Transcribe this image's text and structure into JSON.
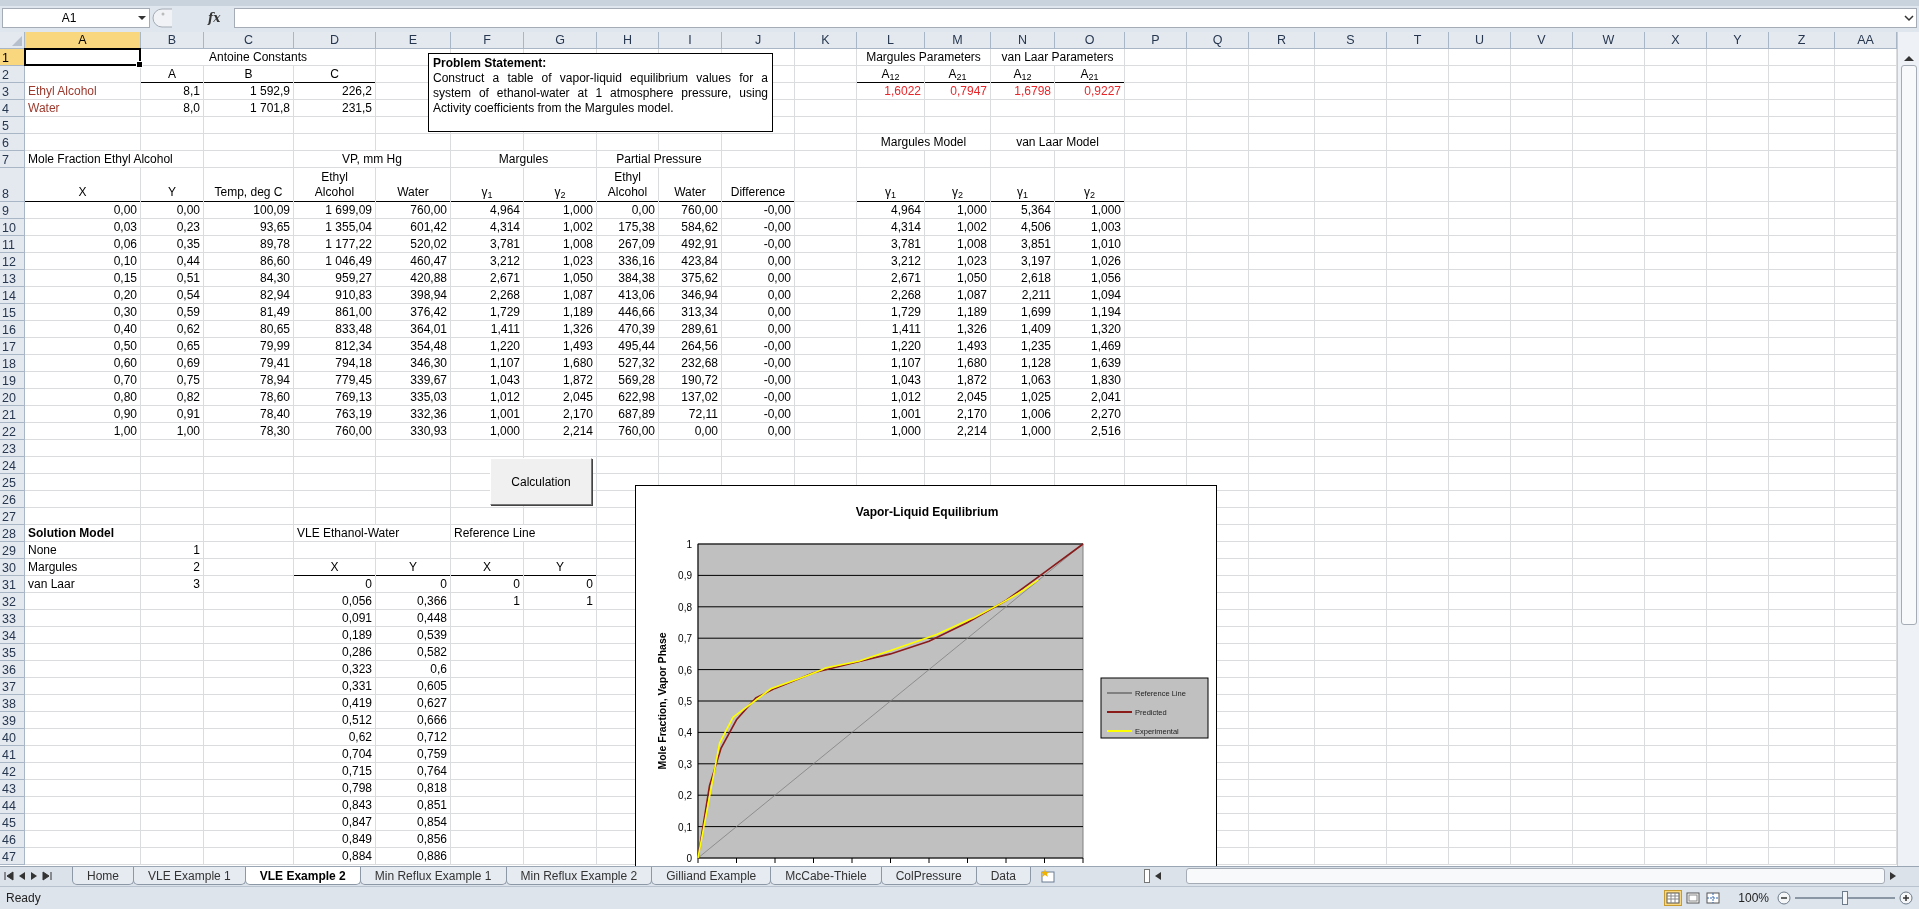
{
  "formula_bar": {
    "name_box": "A1",
    "function_label": "fx"
  },
  "sheet": {
    "columns": [
      {
        "label": "A",
        "selected": true
      },
      {
        "label": "B",
        "selected": false
      },
      {
        "label": "C",
        "selected": false
      },
      {
        "label": "D",
        "selected": false
      },
      {
        "label": "E",
        "selected": false
      },
      {
        "label": "F",
        "selected": false
      },
      {
        "label": "G",
        "selected": false
      },
      {
        "label": "H",
        "selected": false
      },
      {
        "label": "I",
        "selected": false
      },
      {
        "label": "J",
        "selected": false
      },
      {
        "label": "K",
        "selected": false
      },
      {
        "label": "L",
        "selected": false
      },
      {
        "label": "M",
        "selected": false
      },
      {
        "label": "N",
        "selected": false
      },
      {
        "label": "O",
        "selected": false
      },
      {
        "label": "P",
        "selected": false
      },
      {
        "label": "Q",
        "selected": false
      },
      {
        "label": "R",
        "selected": false
      },
      {
        "label": "S",
        "selected": false
      },
      {
        "label": "T",
        "selected": false
      },
      {
        "label": "U",
        "selected": false
      },
      {
        "label": "V",
        "selected": false
      },
      {
        "label": "W",
        "selected": false
      },
      {
        "label": "X",
        "selected": false
      },
      {
        "label": "Y",
        "selected": false
      },
      {
        "label": "Z",
        "selected": false
      },
      {
        "label": "AA",
        "selected": false
      }
    ],
    "rows": [
      {
        "label": "1",
        "selected": true,
        "cells": [
          {
            "selected": true
          },
          {
            "text": "Antoine Constants",
            "kind": "group"
          },
          null,
          null,
          null,
          null,
          null,
          null,
          null,
          null,
          null,
          {
            "text": "Margules Parameters",
            "kind": "group"
          },
          null,
          {
            "text": "van Laar Parameters",
            "kind": "group"
          }
        ]
      },
      {
        "label": "2",
        "selected": false,
        "cells": [
          null,
          {
            "text": "A",
            "kind": "header",
            "underlined": true
          },
          {
            "text": "B",
            "kind": "header",
            "underlined": true
          },
          {
            "text": "C",
            "kind": "header",
            "underlined": true
          },
          null,
          null,
          null,
          null,
          null,
          null,
          null,
          {
            "text": "A$_{12}$",
            "kind": "header",
            "underlined": true
          },
          {
            "text": "A$_{21}$",
            "kind": "header",
            "underlined": true
          },
          {
            "text": "A$_{12}$",
            "kind": "header",
            "underlined": true
          },
          {
            "text": "A$_{21}$",
            "kind": "header",
            "underlined": true
          }
        ]
      },
      {
        "label": "3",
        "selected": false,
        "cells": [
          {
            "text": "Ethyl Alcohol",
            "kind": "label",
            "color": "#9c3a2e"
          },
          {
            "text": "8,1",
            "kind": "number"
          },
          {
            "text": "1 592,9",
            "kind": "number"
          },
          {
            "text": "226,2",
            "kind": "number"
          },
          null,
          null,
          null,
          null,
          null,
          null,
          null,
          {
            "text": "1,6022",
            "kind": "number",
            "color": "#e8262a"
          },
          {
            "text": "0,7947",
            "kind": "number",
            "color": "#e8262a"
          },
          {
            "text": "1,6798",
            "kind": "number",
            "color": "#e8262a"
          },
          {
            "text": "0,9227",
            "kind": "number",
            "color": "#e8262a"
          }
        ]
      },
      {
        "label": "4",
        "selected": false,
        "cells": [
          {
            "text": "Water",
            "kind": "label",
            "color": "#9c3a2e"
          },
          {
            "text": "8,0",
            "kind": "number"
          },
          {
            "text": "1 701,8",
            "kind": "number"
          },
          {
            "text": "231,5",
            "kind": "number"
          }
        ]
      },
      {
        "label": "5",
        "selected": false
      },
      {
        "label": "6",
        "selected": false,
        "cells": [
          null,
          null,
          null,
          null,
          null,
          null,
          null,
          null,
          null,
          null,
          null,
          {
            "text": "Margules Model",
            "kind": "group"
          },
          null,
          {
            "text": "van Laar Model",
            "kind": "group"
          }
        ]
      },
      {
        "label": "7",
        "selected": false,
        "cells": [
          {
            "text": "Mole Fraction Ethyl Alcohol",
            "kind": "label"
          },
          null,
          null,
          {
            "text": "VP, mm Hg",
            "kind": "group"
          },
          null,
          {
            "text": "Margules",
            "kind": "group"
          },
          null,
          {
            "text": "Partial Pressure",
            "kind": "group"
          }
        ]
      },
      {
        "label": "8",
        "selected": false,
        "cells": [
          {
            "text": "X",
            "kind": "column-header",
            "underlined": true
          },
          {
            "text": "Y",
            "kind": "column-header",
            "underlined": true
          },
          {
            "text": "Temp, deg C",
            "kind": "column-header",
            "underlined": true
          },
          {
            "text": "Ethyl\nAlcohol",
            "kind": "column-header",
            "underlined": true
          },
          {
            "text": "Water",
            "kind": "column-header",
            "underlined": true
          },
          {
            "text": "γ$_{1}$",
            "kind": "column-header",
            "underlined": true
          },
          {
            "text": "γ$_{2}$",
            "kind": "column-header",
            "underlined": true
          },
          {
            "text": "Ethyl\nAlcohol",
            "kind": "column-header",
            "underlined": true
          },
          {
            "text": "Water",
            "kind": "column-header",
            "underlined": true
          },
          {
            "text": "Difference",
            "kind": "column-header",
            "underlined": true
          },
          null,
          {
            "text": "γ$_{1}$",
            "kind": "column-header",
            "underlined": true
          },
          {
            "text": "γ$_{2}$",
            "kind": "column-header",
            "underlined": true
          },
          {
            "text": "γ$_{1}$",
            "kind": "column-header",
            "underlined": true
          },
          {
            "text": "γ$_{2}$",
            "kind": "column-header",
            "underlined": true
          }
        ]
      },
      {
        "label": "9",
        "selected": false,
        "cells": [
          {
            "text": "0,00",
            "kind": "number"
          },
          {
            "text": "0,00",
            "kind": "number"
          },
          {
            "text": "100,09",
            "kind": "number"
          },
          {
            "text": "1 699,09",
            "kind": "number"
          },
          {
            "text": "760,00",
            "kind": "number"
          },
          {
            "text": "4,964",
            "kind": "number"
          },
          {
            "text": "1,000",
            "kind": "number"
          },
          {
            "text": "0,00",
            "kind": "number"
          },
          {
            "text": "760,00",
            "kind": "number"
          },
          {
            "text": "-0,00",
            "kind": "number"
          },
          null,
          {
            "text": "4,964",
            "kind": "number"
          },
          {
            "text": "1,000",
            "kind": "number"
          },
          {
            "text": "5,364",
            "kind": "number"
          },
          {
            "text": "1,000",
            "kind": "number"
          }
        ]
      },
      {
        "label": "10",
        "selected": false,
        "cells": [
          {
            "text": "0,03",
            "kind": "number"
          },
          {
            "text": "0,23",
            "kind": "number"
          },
          {
            "text": "93,65",
            "kind": "number"
          },
          {
            "text": "1 355,04",
            "kind": "number"
          },
          {
            "text": "601,42",
            "kind": "number"
          },
          {
            "text": "4,314",
            "kind": "number"
          },
          {
            "text": "1,002",
            "kind": "number"
          },
          {
            "text": "175,38",
            "kind": "number"
          },
          {
            "text": "584,62",
            "kind": "number"
          },
          {
            "text": "-0,00",
            "kind": "number"
          },
          null,
          {
            "text": "4,314",
            "kind": "number"
          },
          {
            "text": "1,002",
            "kind": "number"
          },
          {
            "text": "4,506",
            "kind": "number"
          },
          {
            "text": "1,003",
            "kind": "number"
          }
        ]
      },
      {
        "label": "11",
        "selected": false,
        "cells": [
          {
            "text": "0,06",
            "kind": "number"
          },
          {
            "text": "0,35",
            "kind": "number"
          },
          {
            "text": "89,78",
            "kind": "number"
          },
          {
            "text": "1 177,22",
            "kind": "number"
          },
          {
            "text": "520,02",
            "kind": "number"
          },
          {
            "text": "3,781",
            "kind": "number"
          },
          {
            "text": "1,008",
            "kind": "number"
          },
          {
            "text": "267,09",
            "kind": "number"
          },
          {
            "text": "492,91",
            "kind": "number"
          },
          {
            "text": "-0,00",
            "kind": "number"
          },
          null,
          {
            "text": "3,781",
            "kind": "number"
          },
          {
            "text": "1,008",
            "kind": "number"
          },
          {
            "text": "3,851",
            "kind": "number"
          },
          {
            "text": "1,010",
            "kind": "number"
          }
        ]
      },
      {
        "label": "12",
        "selected": false,
        "cells": [
          {
            "text": "0,10",
            "kind": "number"
          },
          {
            "text": "0,44",
            "kind": "number"
          },
          {
            "text": "86,60",
            "kind": "number"
          },
          {
            "text": "1 046,49",
            "kind": "number"
          },
          {
            "text": "460,47",
            "kind": "number"
          },
          {
            "text": "3,212",
            "kind": "number"
          },
          {
            "text": "1,023",
            "kind": "number"
          },
          {
            "text": "336,16",
            "kind": "number"
          },
          {
            "text": "423,84",
            "kind": "number"
          },
          {
            "text": "0,00",
            "kind": "number"
          },
          null,
          {
            "text": "3,212",
            "kind": "number"
          },
          {
            "text": "1,023",
            "kind": "number"
          },
          {
            "text": "3,197",
            "kind": "number"
          },
          {
            "text": "1,026",
            "kind": "number"
          }
        ]
      },
      {
        "label": "13",
        "selected": false,
        "cells": [
          {
            "text": "0,15",
            "kind": "number"
          },
          {
            "text": "0,51",
            "kind": "number"
          },
          {
            "text": "84,30",
            "kind": "number"
          },
          {
            "text": "959,27",
            "kind": "number"
          },
          {
            "text": "420,88",
            "kind": "number"
          },
          {
            "text": "2,671",
            "kind": "number"
          },
          {
            "text": "1,050",
            "kind": "number"
          },
          {
            "text": "384,38",
            "kind": "number"
          },
          {
            "text": "375,62",
            "kind": "number"
          },
          {
            "text": "0,00",
            "kind": "number"
          },
          null,
          {
            "text": "2,671",
            "kind": "number"
          },
          {
            "text": "1,050",
            "kind": "number"
          },
          {
            "text": "2,618",
            "kind": "number"
          },
          {
            "text": "1,056",
            "kind": "number"
          }
        ]
      },
      {
        "label": "14",
        "selected": false,
        "cells": [
          {
            "text": "0,20",
            "kind": "number"
          },
          {
            "text": "0,54",
            "kind": "number"
          },
          {
            "text": "82,94",
            "kind": "number"
          },
          {
            "text": "910,83",
            "kind": "number"
          },
          {
            "text": "398,94",
            "kind": "number"
          },
          {
            "text": "2,268",
            "kind": "number"
          },
          {
            "text": "1,087",
            "kind": "number"
          },
          {
            "text": "413,06",
            "kind": "number"
          },
          {
            "text": "346,94",
            "kind": "number"
          },
          {
            "text": "0,00",
            "kind": "number"
          },
          null,
          {
            "text": "2,268",
            "kind": "number"
          },
          {
            "text": "1,087",
            "kind": "number"
          },
          {
            "text": "2,211",
            "kind": "number"
          },
          {
            "text": "1,094",
            "kind": "number"
          }
        ]
      },
      {
        "label": "15",
        "selected": false,
        "cells": [
          {
            "text": "0,30",
            "kind": "number"
          },
          {
            "text": "0,59",
            "kind": "number"
          },
          {
            "text": "81,49",
            "kind": "number"
          },
          {
            "text": "861,00",
            "kind": "number"
          },
          {
            "text": "376,42",
            "kind": "number"
          },
          {
            "text": "1,729",
            "kind": "number"
          },
          {
            "text": "1,189",
            "kind": "number"
          },
          {
            "text": "446,66",
            "kind": "number"
          },
          {
            "text": "313,34",
            "kind": "number"
          },
          {
            "text": "0,00",
            "kind": "number"
          },
          null,
          {
            "text": "1,729",
            "kind": "number"
          },
          {
            "text": "1,189",
            "kind": "number"
          },
          {
            "text": "1,699",
            "kind": "number"
          },
          {
            "text": "1,194",
            "kind": "number"
          }
        ]
      },
      {
        "label": "16",
        "selected": false,
        "cells": [
          {
            "text": "0,40",
            "kind": "number"
          },
          {
            "text": "0,62",
            "kind": "number"
          },
          {
            "text": "80,65",
            "kind": "number"
          },
          {
            "text": "833,48",
            "kind": "number"
          },
          {
            "text": "364,01",
            "kind": "number"
          },
          {
            "text": "1,411",
            "kind": "number"
          },
          {
            "text": "1,326",
            "kind": "number"
          },
          {
            "text": "470,39",
            "kind": "number"
          },
          {
            "text": "289,61",
            "kind": "number"
          },
          {
            "text": "0,00",
            "kind": "number"
          },
          null,
          {
            "text": "1,411",
            "kind": "number"
          },
          {
            "text": "1,326",
            "kind": "number"
          },
          {
            "text": "1,409",
            "kind": "number"
          },
          {
            "text": "1,320",
            "kind": "number"
          }
        ]
      },
      {
        "label": "17",
        "selected": false,
        "cells": [
          {
            "text": "0,50",
            "kind": "number"
          },
          {
            "text": "0,65",
            "kind": "number"
          },
          {
            "text": "79,99",
            "kind": "number"
          },
          {
            "text": "812,34",
            "kind": "number"
          },
          {
            "text": "354,48",
            "kind": "number"
          },
          {
            "text": "1,220",
            "kind": "number"
          },
          {
            "text": "1,493",
            "kind": "number"
          },
          {
            "text": "495,44",
            "kind": "number"
          },
          {
            "text": "264,56",
            "kind": "number"
          },
          {
            "text": "-0,00",
            "kind": "number"
          },
          null,
          {
            "text": "1,220",
            "kind": "number"
          },
          {
            "text": "1,493",
            "kind": "number"
          },
          {
            "text": "1,235",
            "kind": "number"
          },
          {
            "text": "1,469",
            "kind": "number"
          }
        ]
      },
      {
        "label": "18",
        "selected": false,
        "cells": [
          {
            "text": "0,60",
            "kind": "number"
          },
          {
            "text": "0,69",
            "kind": "number"
          },
          {
            "text": "79,41",
            "kind": "number"
          },
          {
            "text": "794,18",
            "kind": "number"
          },
          {
            "text": "346,30",
            "kind": "number"
          },
          {
            "text": "1,107",
            "kind": "number"
          },
          {
            "text": "1,680",
            "kind": "number"
          },
          {
            "text": "527,32",
            "kind": "number"
          },
          {
            "text": "232,68",
            "kind": "number"
          },
          {
            "text": "-0,00",
            "kind": "number"
          },
          null,
          {
            "text": "1,107",
            "kind": "number"
          },
          {
            "text": "1,680",
            "kind": "number"
          },
          {
            "text": "1,128",
            "kind": "number"
          },
          {
            "text": "1,639",
            "kind": "number"
          }
        ]
      },
      {
        "label": "19",
        "selected": false,
        "cells": [
          {
            "text": "0,70",
            "kind": "number"
          },
          {
            "text": "0,75",
            "kind": "number"
          },
          {
            "text": "78,94",
            "kind": "number"
          },
          {
            "text": "779,45",
            "kind": "number"
          },
          {
            "text": "339,67",
            "kind": "number"
          },
          {
            "text": "1,043",
            "kind": "number"
          },
          {
            "text": "1,872",
            "kind": "number"
          },
          {
            "text": "569,28",
            "kind": "number"
          },
          {
            "text": "190,72",
            "kind": "number"
          },
          {
            "text": "-0,00",
            "kind": "number"
          },
          null,
          {
            "text": "1,043",
            "kind": "number"
          },
          {
            "text": "1,872",
            "kind": "number"
          },
          {
            "text": "1,063",
            "kind": "number"
          },
          {
            "text": "1,830",
            "kind": "number"
          }
        ]
      },
      {
        "label": "20",
        "selected": false,
        "cells": [
          {
            "text": "0,80",
            "kind": "number"
          },
          {
            "text": "0,82",
            "kind": "number"
          },
          {
            "text": "78,60",
            "kind": "number"
          },
          {
            "text": "769,13",
            "kind": "number"
          },
          {
            "text": "335,03",
            "kind": "number"
          },
          {
            "text": "1,012",
            "kind": "number"
          },
          {
            "text": "2,045",
            "kind": "number"
          },
          {
            "text": "622,98",
            "kind": "number"
          },
          {
            "text": "137,02",
            "kind": "number"
          },
          {
            "text": "-0,00",
            "kind": "number"
          },
          null,
          {
            "text": "1,012",
            "kind": "number"
          },
          {
            "text": "2,045",
            "kind": "number"
          },
          {
            "text": "1,025",
            "kind": "number"
          },
          {
            "text": "2,041",
            "kind": "number"
          }
        ]
      },
      {
        "label": "21",
        "selected": false,
        "cells": [
          {
            "text": "0,90",
            "kind": "number"
          },
          {
            "text": "0,91",
            "kind": "number"
          },
          {
            "text": "78,40",
            "kind": "number"
          },
          {
            "text": "763,19",
            "kind": "number"
          },
          {
            "text": "332,36",
            "kind": "number"
          },
          {
            "text": "1,001",
            "kind": "number"
          },
          {
            "text": "2,170",
            "kind": "number"
          },
          {
            "text": "687,89",
            "kind": "number"
          },
          {
            "text": "72,11",
            "kind": "number"
          },
          {
            "text": "-0,00",
            "kind": "number"
          },
          null,
          {
            "text": "1,001",
            "kind": "number"
          },
          {
            "text": "2,170",
            "kind": "number"
          },
          {
            "text": "1,006",
            "kind": "number"
          },
          {
            "text": "2,270",
            "kind": "number"
          }
        ]
      },
      {
        "label": "22",
        "selected": false,
        "cells": [
          {
            "text": "1,00",
            "kind": "number"
          },
          {
            "text": "1,00",
            "kind": "number"
          },
          {
            "text": "78,30",
            "kind": "number"
          },
          {
            "text": "760,00",
            "kind": "number"
          },
          {
            "text": "330,93",
            "kind": "number"
          },
          {
            "text": "1,000",
            "kind": "number"
          },
          {
            "text": "2,214",
            "kind": "number"
          },
          {
            "text": "760,00",
            "kind": "number"
          },
          {
            "text": "0,00",
            "kind": "number"
          },
          {
            "text": "0,00",
            "kind": "number"
          },
          null,
          {
            "text": "1,000",
            "kind": "number"
          },
          {
            "text": "2,214",
            "kind": "number"
          },
          {
            "text": "1,000",
            "kind": "number"
          },
          {
            "text": "2,516",
            "kind": "number"
          }
        ]
      },
      {
        "label": "23",
        "selected": false
      },
      {
        "label": "24",
        "selected": false
      },
      {
        "label": "25",
        "selected": false
      },
      {
        "label": "26",
        "selected": false
      },
      {
        "label": "27",
        "selected": false
      },
      {
        "label": "28",
        "selected": false,
        "cells": [
          {
            "text": "Solution Model",
            "kind": "label",
            "bold": true
          },
          null,
          null,
          {
            "text": "VLE Ethanol-Water",
            "kind": "label"
          },
          null,
          {
            "text": "Reference Line",
            "kind": "label"
          }
        ]
      },
      {
        "label": "29",
        "selected": false,
        "cells": [
          {
            "text": "None",
            "kind": "label"
          },
          {
            "text": "1",
            "kind": "number"
          }
        ]
      },
      {
        "label": "30",
        "selected": false,
        "cells": [
          {
            "text": "Margules",
            "kind": "label"
          },
          {
            "text": "2",
            "kind": "number"
          },
          null,
          {
            "text": "X",
            "kind": "header",
            "underlined": true
          },
          {
            "text": "Y",
            "kind": "header",
            "underlined": true
          },
          {
            "text": "X",
            "kind": "header",
            "underlined": true
          },
          {
            "text": "Y",
            "kind": "header",
            "underlined": true
          }
        ]
      },
      {
        "label": "31",
        "selected": false,
        "cells": [
          {
            "text": "van Laar",
            "kind": "label"
          },
          {
            "text": "3",
            "kind": "number"
          },
          null,
          {
            "text": "0",
            "kind": "number"
          },
          {
            "text": "0",
            "kind": "number"
          },
          {
            "text": "0",
            "kind": "number"
          },
          {
            "text": "0",
            "kind": "number"
          }
        ]
      },
      {
        "label": "32",
        "selected": false,
        "cells": [
          null,
          null,
          null,
          {
            "text": "0,056",
            "kind": "number"
          },
          {
            "text": "0,366",
            "kind": "number"
          },
          {
            "text": "1",
            "kind": "number"
          },
          {
            "text": "1",
            "kind": "number"
          }
        ]
      },
      {
        "label": "33",
        "selected": false,
        "cells": [
          null,
          null,
          null,
          {
            "text": "0,091",
            "kind": "number"
          },
          {
            "text": "0,448",
            "kind": "number"
          }
        ]
      },
      {
        "label": "34",
        "selected": false,
        "cells": [
          null,
          null,
          null,
          {
            "text": "0,189",
            "kind": "number"
          },
          {
            "text": "0,539",
            "kind": "number"
          }
        ]
      },
      {
        "label": "35",
        "selected": false,
        "cells": [
          null,
          null,
          null,
          {
            "text": "0,286",
            "kind": "number"
          },
          {
            "text": "0,582",
            "kind": "number"
          }
        ]
      },
      {
        "label": "36",
        "selected": false,
        "cells": [
          null,
          null,
          null,
          {
            "text": "0,323",
            "kind": "number"
          },
          {
            "text": "0,6",
            "kind": "number"
          }
        ]
      },
      {
        "label": "37",
        "selected": false,
        "cells": [
          null,
          null,
          null,
          {
            "text": "0,331",
            "kind": "number"
          },
          {
            "text": "0,605",
            "kind": "number"
          }
        ]
      },
      {
        "label": "38",
        "selected": false,
        "cells": [
          null,
          null,
          null,
          {
            "text": "0,419",
            "kind": "number"
          },
          {
            "text": "0,627",
            "kind": "number"
          }
        ]
      },
      {
        "label": "39",
        "selected": false,
        "cells": [
          null,
          null,
          null,
          {
            "text": "0,512",
            "kind": "number"
          },
          {
            "text": "0,666",
            "kind": "number"
          }
        ]
      },
      {
        "label": "40",
        "selected": false,
        "cells": [
          null,
          null,
          null,
          {
            "text": "0,62",
            "kind": "number"
          },
          {
            "text": "0,712",
            "kind": "number"
          }
        ]
      },
      {
        "label": "41",
        "selected": false,
        "cells": [
          null,
          null,
          null,
          {
            "text": "0,704",
            "kind": "number"
          },
          {
            "text": "0,759",
            "kind": "number"
          }
        ]
      },
      {
        "label": "42",
        "selected": false,
        "cells": [
          null,
          null,
          null,
          {
            "text": "0,715",
            "kind": "number"
          },
          {
            "text": "0,764",
            "kind": "number"
          }
        ]
      },
      {
        "label": "43",
        "selected": false,
        "cells": [
          null,
          null,
          null,
          {
            "text": "0,798",
            "kind": "number"
          },
          {
            "text": "0,818",
            "kind": "number"
          }
        ]
      },
      {
        "label": "44",
        "selected": false,
        "cells": [
          null,
          null,
          null,
          {
            "text": "0,843",
            "kind": "number"
          },
          {
            "text": "0,851",
            "kind": "number"
          }
        ]
      },
      {
        "label": "45",
        "selected": false,
        "cells": [
          null,
          null,
          null,
          {
            "text": "0,847",
            "kind": "number"
          },
          {
            "text": "0,854",
            "kind": "number"
          }
        ]
      },
      {
        "label": "46",
        "selected": false,
        "cells": [
          null,
          null,
          null,
          {
            "text": "0,849",
            "kind": "number"
          },
          {
            "text": "0,856",
            "kind": "number"
          }
        ]
      },
      {
        "label": "47",
        "selected": false,
        "cells": [
          null,
          null,
          null,
          {
            "text": "0,884",
            "kind": "number"
          },
          {
            "text": "0,886",
            "kind": "number"
          }
        ]
      }
    ],
    "problem_statement": {
      "title": "Problem Statement:",
      "text": "Construct a table of vapor-liquid  equilibrium values for a system of ethanol-water at 1 atmosphere pressure, using Activity coefficients from the Margules model."
    },
    "button": {
      "label": "Calculation"
    },
    "chart": {
      "title": "Vapor-Liquid  Equilibrium",
      "axis_title": "Mole Fraction, Vapor Phase",
      "gridlines": true,
      "tick_labels": [
        "1",
        "0,9",
        "0,8",
        "0,7",
        "0,6",
        "0,5",
        "0,4",
        "0,3",
        "0,2",
        "0,1",
        "0"
      ],
      "legend": [
        {
          "name": "Reference Line",
          "color": "#808080"
        },
        {
          "name": "Predicted",
          "color": "#8b1a1a"
        },
        {
          "name": "Experimental",
          "color": "#ffff00"
        }
      ]
    }
  },
  "sheet_tabs": [
    {
      "label": "Home",
      "selected": false
    },
    {
      "label": "VLE Example 1",
      "selected": false
    },
    {
      "label": "VLE Example 2",
      "selected": true
    },
    {
      "label": "Min Reflux Example 1",
      "selected": false
    },
    {
      "label": "Min Reflux Example 2",
      "selected": false
    },
    {
      "label": "Gilliand Example",
      "selected": false
    },
    {
      "label": "McCabe-Thiele",
      "selected": false
    },
    {
      "label": "ColPressure",
      "selected": false
    },
    {
      "label": "Data",
      "selected": false
    }
  ],
  "status_bar": {
    "text": "Ready",
    "views": [
      {
        "kind": "normal",
        "selected": true
      },
      {
        "kind": "page-layout",
        "selected": false
      },
      {
        "kind": "page-break",
        "selected": false
      }
    ],
    "zoom": {
      "label": "100%",
      "level": 0.5
    }
  }
}
